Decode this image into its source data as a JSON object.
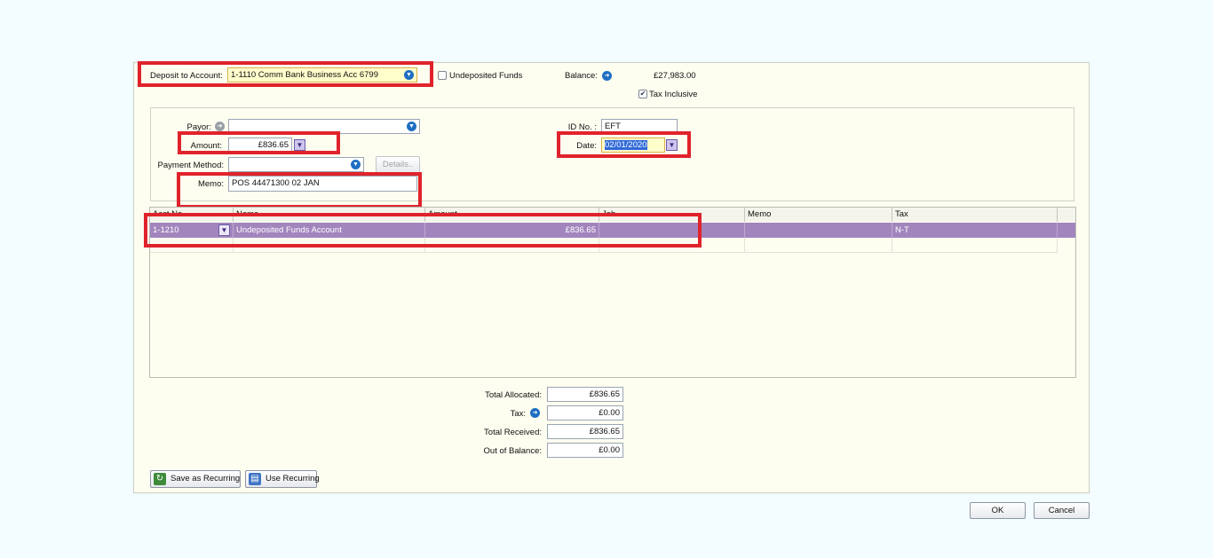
{
  "deposit": {
    "label": "Deposit to Account:",
    "account_value": "1-1110 Comm Bank Business Acc 6799",
    "undeposited_label": "Undeposited Funds",
    "balance_label": "Balance:",
    "balance_value": "£27,983.00",
    "tax_inclusive_label": "Tax Inclusive"
  },
  "form": {
    "payor_label": "Payor:",
    "payor_value": "",
    "amount_label": "Amount:",
    "amount_value": "£836.65",
    "payment_method_label": "Payment Method:",
    "payment_method_value": "",
    "details_label": "Details..",
    "memo_label": "Memo:",
    "memo_value": "POS 44471300 02 JAN",
    "id_label": "ID No. :",
    "id_value": "EFT",
    "date_label": "Date:",
    "date_value": "02/01/2020"
  },
  "grid": {
    "headers": [
      "Acct No.",
      "Name",
      "Amount",
      "Job",
      "Memo",
      "Tax"
    ],
    "rows": [
      {
        "acct": "1-1210",
        "name": "Undeposited Funds Account",
        "amount": "£836.65",
        "job": "",
        "memo": "",
        "tax": "N-T"
      }
    ]
  },
  "totals": {
    "allocated_label": "Total Allocated:",
    "allocated_value": "£836.65",
    "tax_label": "Tax:",
    "tax_value": "£0.00",
    "received_label": "Total Received:",
    "received_value": "£836.65",
    "out_label": "Out of Balance:",
    "out_value": "£0.00"
  },
  "buttons": {
    "save_recurring": "Save as Recurring",
    "use_recurring": "Use Recurring",
    "ok": "OK",
    "cancel": "Cancel"
  },
  "colors": {
    "selected_row": "#a285bd",
    "annotation_red": "#e0232b",
    "panel_bg": "#fdfdf0"
  }
}
